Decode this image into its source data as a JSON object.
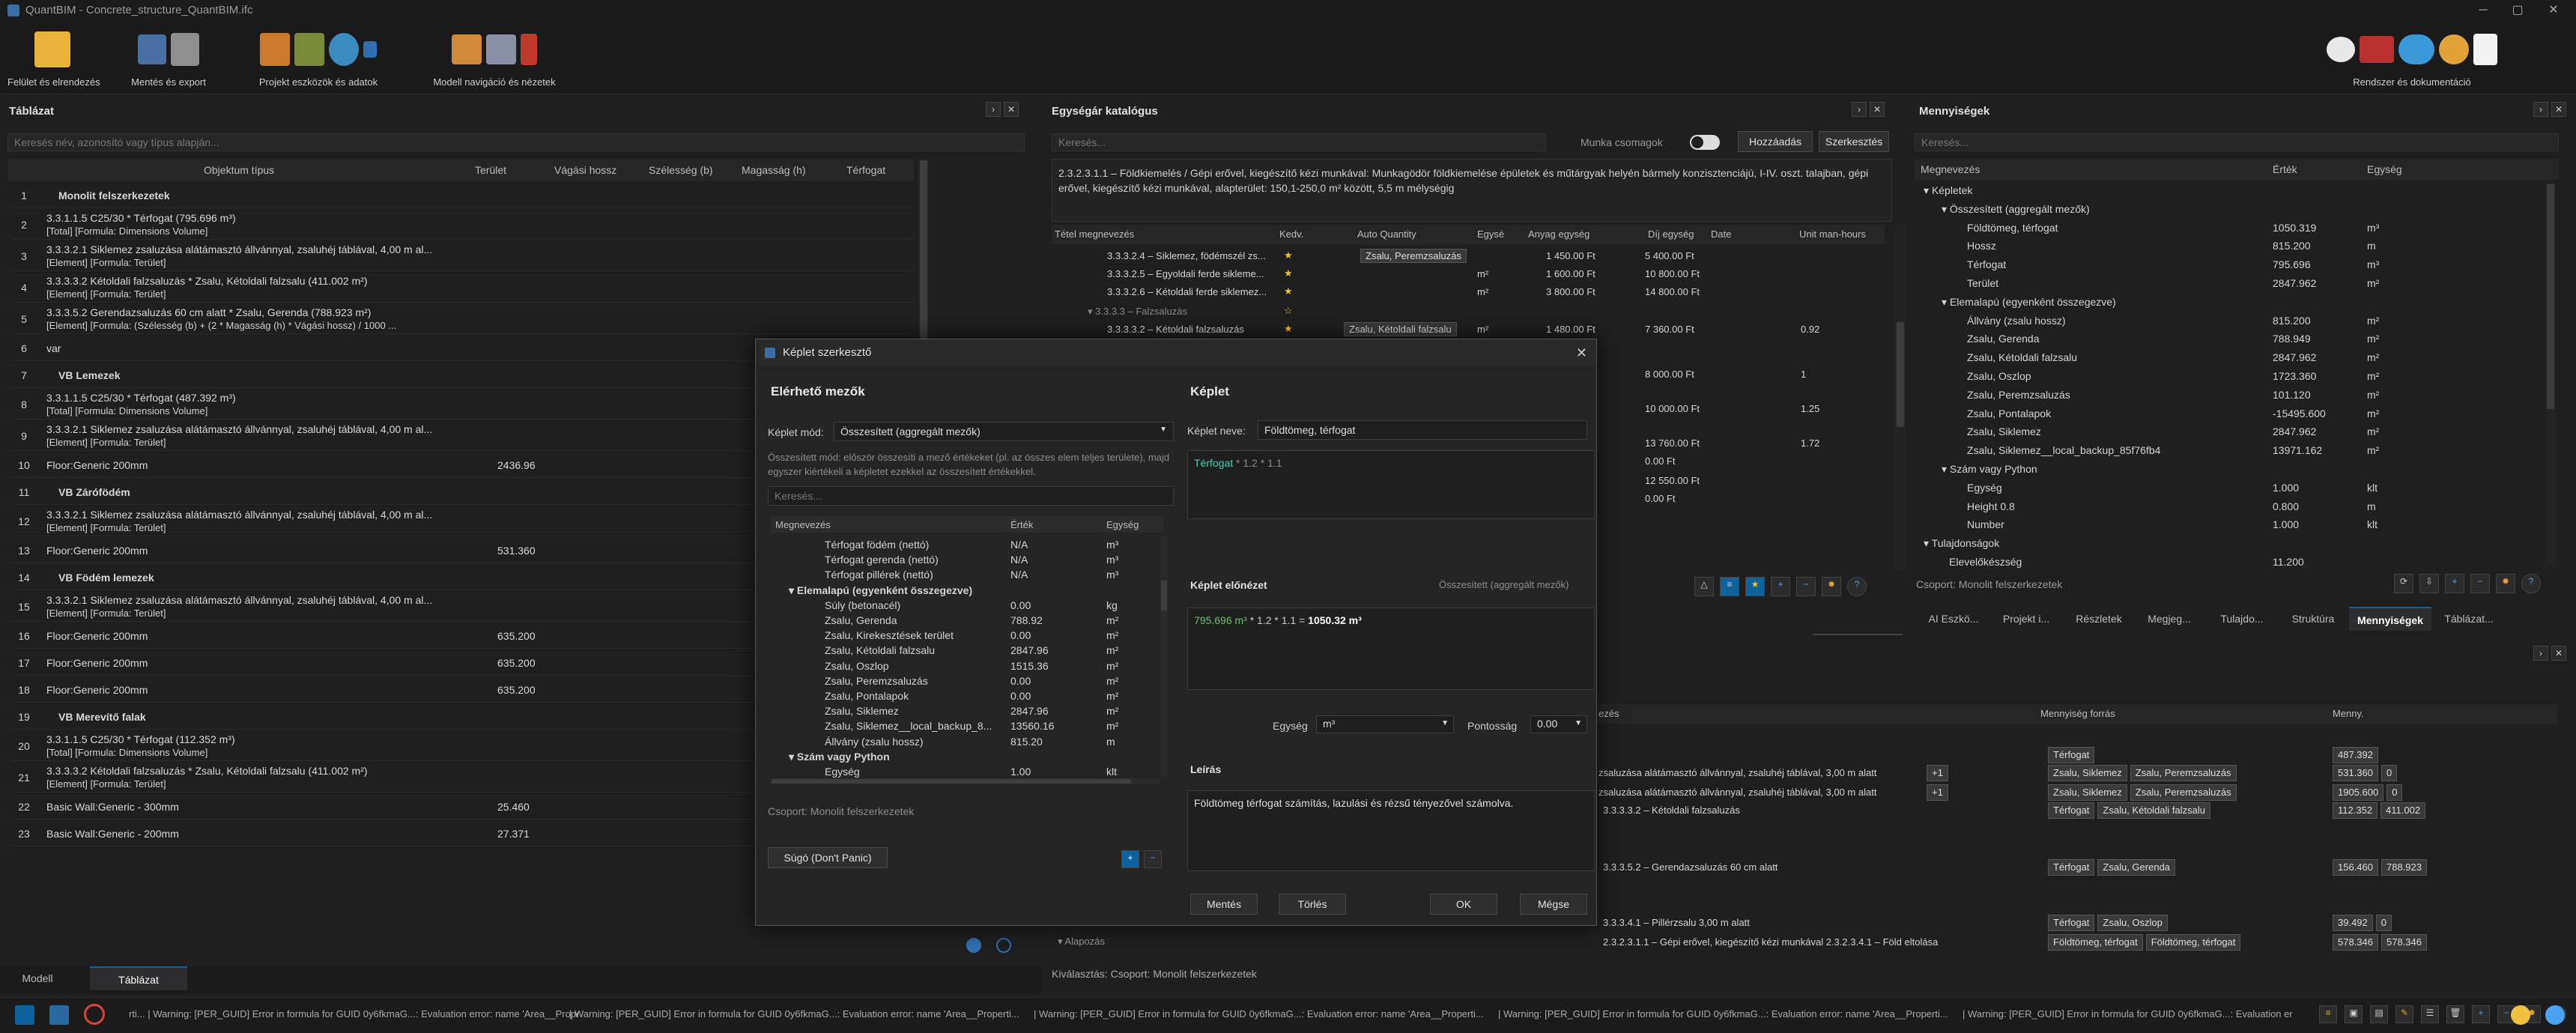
{
  "window": {
    "title": "QuantBIM - Concrete_structure_QuantBIM.ifc"
  },
  "ribbon": {
    "groups": [
      {
        "label": "Felület és elrendezés"
      },
      {
        "label": "Mentés és export"
      },
      {
        "label": "Projekt eszközök és adatok"
      },
      {
        "label": "Modell navigáció és nézetek"
      },
      {
        "label": "Rendszer és dokumentáció"
      }
    ]
  },
  "table_panel": {
    "title": "Táblázat",
    "search_placeholder": "Keresés név, azonosító vagy típus alapján...",
    "headers": [
      "Objektum típus",
      "Terület",
      "Vágási hossz",
      "Szélesség (b)",
      "Magasság (h)",
      "Térfogat"
    ],
    "rows": [
      {
        "num": "1",
        "text": "Monolit felszerkezetek",
        "group": true
      },
      {
        "num": "2",
        "text": "3.3.1.1.5 C25/30 * Térfogat   (795.696 m³)",
        "sub": "[Total] [Formula: Dimensions Volume]"
      },
      {
        "num": "3",
        "text": "3.3.3.2.1 Siklemez zsaluzása alátámasztó állvánnyal, zsaluhéj táblával, 4,00 m al...",
        "sub": "[Element] [Formula: Terület]"
      },
      {
        "num": "4",
        "text": "3.3.3.3.2 Kétoldali falzsaluzás * Zsalu, Kétoldali falzsalu   (411.002 m²)",
        "sub": "[Element] [Formula: Terület]"
      },
      {
        "num": "5",
        "text": "3.3.3.5.2 Gerendazsaluzás 60 cm alatt * Zsalu, Gerenda   (788.923 m²)",
        "sub": "[Element] [Formula: (Szélesség (b) + (2 * Magasság (h) * Vágási hossz) / 1000 ..."
      },
      {
        "num": "6",
        "text": "var"
      },
      {
        "num": "7",
        "text": "VB Lemezek",
        "group": true
      },
      {
        "num": "8",
        "text": "3.3.1.1.5 C25/30 * Térfogat   (487.392 m³)",
        "sub": "[Total] [Formula: Dimensions Volume]"
      },
      {
        "num": "9",
        "text": "3.3.3.2.1 Siklemez zsaluzása alátámasztó állvánnyal, zsaluhéj táblával, 4,00 m al...",
        "sub": "[Element] [Formula: Terület]"
      },
      {
        "num": "10",
        "text": "Floor:Generic 200mm",
        "area": "2436.96"
      },
      {
        "num": "11",
        "text": "VB Zárófödém",
        "group": true
      },
      {
        "num": "12",
        "text": "3.3.3.2.1 Siklemez zsaluzása alátámasztó állvánnyal, zsaluhéj táblával, 4,00 m al...",
        "sub": "[Element] [Formula: Terület]"
      },
      {
        "num": "13",
        "text": "Floor:Generic 200mm",
        "area": "531.360"
      },
      {
        "num": "14",
        "text": "VB Födém lemezek",
        "group": true
      },
      {
        "num": "15",
        "text": "3.3.3.2.1 Siklemez zsaluzása alátámasztó állvánnyal, zsaluhéj táblával, 4,00 m al...",
        "sub": "[Element] [Formula: Terület]"
      },
      {
        "num": "16",
        "text": "Floor:Generic 200mm",
        "area": "635.200"
      },
      {
        "num": "17",
        "text": "Floor:Generic 200mm",
        "area": "635.200"
      },
      {
        "num": "18",
        "text": "Floor:Generic 200mm",
        "area": "635.200"
      },
      {
        "num": "19",
        "text": "VB Merevítő falak",
        "group": true
      },
      {
        "num": "20",
        "text": "3.3.1.1.5 C25/30 * Térfogat   (112.352 m³)",
        "sub": "[Total] [Formula: Dimensions Volume]"
      },
      {
        "num": "21",
        "text": "3.3.3.3.2 Kétoldali falzsaluzás * Zsalu, Kétoldali falzsalu   (411.002 m²)",
        "sub": "[Element] [Formula: Terület]"
      },
      {
        "num": "22",
        "text": "Basic Wall:Generic - 300mm",
        "area": "25.460"
      },
      {
        "num": "23",
        "text": "Basic Wall:Generic - 200mm",
        "area": "27.371"
      }
    ],
    "bottom_tabs": [
      "Modell",
      "Táblázat"
    ]
  },
  "catalog_panel": {
    "title": "Egységár katalógus",
    "search_placeholder": "Keresés...",
    "work_packages_label": "Munka csomagok",
    "add_button": "Hozzáadás",
    "edit_button": "Szerkesztés",
    "description": "2.3.2.3.1.1 – Földkiemelés / Gépi erővel, kiegészítő kézi munkával: Munkagödör földkiemelése épületek és műtárgyak helyén bármely konzisztenciájú, I-IV. oszt. talajban, gépi erővel, kiegészítő kézi munkával, alapterület: 150,1-250,0 m² között, 5,5 m mélységig",
    "headers": [
      "Tétel megnevezés",
      "Kedv.",
      "Auto Quantity",
      "Egysé",
      "Anyag egység",
      "Díj egység",
      "Date",
      "Unit man-hours"
    ],
    "rows": [
      {
        "name": "3.3.3.2.4 – Siklemez, födémszél zs...",
        "fav": "★",
        "auto": "Zsalu, Peremzsaluzás",
        "unit": "",
        "mat": "1 450.00 Ft",
        "fee": "5 400.00 Ft",
        "mh": ""
      },
      {
        "name": "3.3.3.2.5 – Egyoldali ferde siklemе...",
        "fav": "★",
        "auto": "",
        "unit": "m²",
        "mat": "1 600.00 Ft",
        "fee": "10 800.00 Ft",
        "mh": ""
      },
      {
        "name": "3.3.3.2.6 – Kétoldali ferde siklemez...",
        "fav": "★",
        "auto": "",
        "unit": "m²",
        "mat": "3 800.00 Ft",
        "fee": "14 800.00 Ft",
        "mh": ""
      },
      {
        "name": "▾ 3.3.3.3 – Falzsaluzás",
        "fav": "☆",
        "auto": "",
        "unit": "",
        "mat": "",
        "fee": "",
        "mh": ""
      },
      {
        "name": "3.3.3.3.2 – Kétoldali falzsaluzás",
        "fav": "★",
        "auto": "Zsalu, Kétoldali falzsalu",
        "unit": "m²",
        "mat": "1 480.00 Ft",
        "fee": "7 360.00 Ft",
        "mh": "0.92"
      }
    ],
    "partial_rows": [
      {
        "fee": "8 000.00 Ft",
        "mh": "1"
      },
      {
        "fee": "10 000.00 Ft",
        "mh": "1.25"
      },
      {
        "fee": "13 760.00 Ft",
        "mh": "1.72"
      },
      {
        "fee": "0.00 Ft",
        "mh": ""
      },
      {
        "fee": "12 550.00 Ft",
        "mh": ""
      },
      {
        "fee": "0.00 Ft",
        "mh": ""
      }
    ],
    "selection_label": "Kiválasztás:  Csoport: Monolit felszerkezetek",
    "lower_headers": [
      "ezés",
      "Mennyiség forrás",
      "Menny."
    ],
    "lower_rows": [
      {
        "text": "",
        "src": [
          "Térfogat"
        ],
        "qty": [
          "487.392"
        ]
      },
      {
        "text": "zsaluzása alátámasztó állvánnyal, zsaluhéj táblával, 3,00 m alatt",
        "badge": "+1",
        "src": [
          "Zsalu, Siklemez",
          "Zsalu, Peremzsaluzás"
        ],
        "qty": [
          "531.360",
          "0"
        ]
      },
      {
        "text": "zsaluzása alátámasztó állvánnyal, zsaluhéj táblával, 3,00 m alatt",
        "badge": "+1",
        "src": [
          "Zsalu, Siklemez",
          "Zsalu, Peremzsaluzás"
        ],
        "qty": [
          "1905.600",
          "0"
        ]
      },
      {
        "text": "3.3.3.3.2 – Kétoldali falzsaluzás",
        "src": [
          "Térfogat",
          "Zsalu, Kétoldali falzsalu"
        ],
        "qty": [
          "112.352",
          "411.002"
        ]
      },
      {
        "text": "3.3.3.5.2 – Gerendazsaluzás 60 cm alatt",
        "src": [
          "Térfogat",
          "Zsalu, Gerenda"
        ],
        "qty": [
          "156.460",
          "788.923"
        ]
      },
      {
        "text": "3.3.3.4.1 – Pillérzsalu 3,00 m alatt",
        "src": [
          "Térfogat",
          "Zsalu, Oszlop"
        ],
        "qty": [
          "39.492",
          "0"
        ]
      },
      {
        "text": "2.3.2.3.1.1 – Gépi erővel, kiegészítő kézi munkával   2.3.2.3.4.1 – Föld eltolása",
        "src": [
          "Földtömeg, térfogat",
          "Földtömeg, térfogat"
        ],
        "qty": [
          "578.346",
          "578.346"
        ]
      }
    ],
    "lower_group": "▾ Alapozás"
  },
  "qty_panel": {
    "title": "Mennyiségek",
    "search_placeholder": "Keresés...",
    "headers": [
      "Megnevezés",
      "Érték",
      "Egység"
    ],
    "rows": [
      {
        "indent": 0,
        "name": "▾ Képletek",
        "val": "",
        "unit": ""
      },
      {
        "indent": 1,
        "name": "▾ Összesített (aggregált mezők)",
        "val": "",
        "unit": ""
      },
      {
        "indent": 2,
        "name": "Földtömeg, térfogat",
        "val": "1050.319",
        "unit": "m³"
      },
      {
        "indent": 2,
        "name": "Hossz",
        "val": "815.200",
        "unit": "m"
      },
      {
        "indent": 2,
        "name": "Térfogat",
        "val": "795.696",
        "unit": "m³"
      },
      {
        "indent": 2,
        "name": "Terület",
        "val": "2847.962",
        "unit": "m²"
      },
      {
        "indent": 1,
        "name": "▾ Elemalapú (egyenként összegezve)",
        "val": "",
        "unit": ""
      },
      {
        "indent": 2,
        "name": "Állvány (zsalu hossz)",
        "val": "815.200",
        "unit": "m²"
      },
      {
        "indent": 2,
        "name": "Zsalu, Gerenda",
        "val": "788.949",
        "unit": "m²"
      },
      {
        "indent": 2,
        "name": "Zsalu, Kétoldali falzsalu",
        "val": "2847.962",
        "unit": "m²"
      },
      {
        "indent": 2,
        "name": "Zsalu, Oszlop",
        "val": "1723.360",
        "unit": "m²"
      },
      {
        "indent": 2,
        "name": "Zsalu, Peremzsaluzás",
        "val": "101.120",
        "unit": "m²"
      },
      {
        "indent": 2,
        "name": "Zsalu, Pontalapok",
        "val": "-15495.600",
        "unit": "m²"
      },
      {
        "indent": 2,
        "name": "Zsalu, Siklemez",
        "val": "2847.962",
        "unit": "m²"
      },
      {
        "indent": 2,
        "name": "Zsalu, Siklemez__local_backup_85f76fb4",
        "val": "13971.162",
        "unit": "m²"
      },
      {
        "indent": 1,
        "name": "▾ Szám vagy Python",
        "val": "",
        "unit": ""
      },
      {
        "indent": 2,
        "name": "Egység",
        "val": "1.000",
        "unit": "klt"
      },
      {
        "indent": 2,
        "name": "Height 0.8",
        "val": "0.800",
        "unit": "m"
      },
      {
        "indent": 2,
        "name": "Number",
        "val": "1.000",
        "unit": "klt"
      },
      {
        "indent": 0,
        "name": "▾ Tulajdonságok",
        "val": "",
        "unit": ""
      },
      {
        "indent": 1,
        "name": "Elevelőkészség",
        "val": "11.200",
        "unit": ""
      }
    ],
    "group_label": "Csoport: Monolit felszerkezetek",
    "tabs": [
      "AI Eszkö...",
      "Projekt i...",
      "Részletek",
      "Megjeg...",
      "Tulajdo...",
      "Struktúra",
      "Mennyiségek",
      "Táblázat..."
    ]
  },
  "modal": {
    "title": "Képlet szerkesztő",
    "left_heading": "Elérhető mezők",
    "mode_label": "Képlet mód:",
    "mode_value": "Összesített (aggregált mezők)",
    "mode_help": "Összesített mód: először összesíti a mező értékeket (pl. az összes elem teljes területe), majd egyszer kiértékeli a képletet ezekkel az összesített értékekkel.",
    "search_placeholder": "Keresés...",
    "headers": [
      "Megnevezés",
      "Érték",
      "Egység"
    ],
    "rows": [
      {
        "indent": 2,
        "name": "Térfogat födém (nettó)",
        "val": "N/A",
        "unit": "m³"
      },
      {
        "indent": 2,
        "name": "Térfogat gerenda (nettó)",
        "val": "N/A",
        "unit": "m³"
      },
      {
        "indent": 2,
        "name": "Térfogat pillérek (nettó)",
        "val": "N/A",
        "unit": "m³"
      },
      {
        "indent": 1,
        "name": "▾ Elemalapú (egyenként összegezve)",
        "val": "",
        "unit": "",
        "bold": true
      },
      {
        "indent": 2,
        "name": "Súly (betonacél)",
        "val": "0.00",
        "unit": "kg"
      },
      {
        "indent": 2,
        "name": "Zsalu, Gerenda",
        "val": "788.92",
        "unit": "m²"
      },
      {
        "indent": 2,
        "name": "Zsalu, Kirekesztések terület",
        "val": "0.00",
        "unit": "m²"
      },
      {
        "indent": 2,
        "name": "Zsalu, Kétoldali falzsalu",
        "val": "2847.96",
        "unit": "m²"
      },
      {
        "indent": 2,
        "name": "Zsalu, Oszlop",
        "val": "1515.36",
        "unit": "m²"
      },
      {
        "indent": 2,
        "name": "Zsalu, Peremzsaluzás",
        "val": "0.00",
        "unit": "m²"
      },
      {
        "indent": 2,
        "name": "Zsalu, Pontalapok",
        "val": "0.00",
        "unit": "m²"
      },
      {
        "indent": 2,
        "name": "Zsalu, Siklemez",
        "val": "2847.96",
        "unit": "m²"
      },
      {
        "indent": 2,
        "name": "Zsalu, Siklemez__local_backup_8...",
        "val": "13560.16",
        "unit": "m²"
      },
      {
        "indent": 2,
        "name": "Állvány (zsalu hossz)",
        "val": "815.20",
        "unit": "m"
      },
      {
        "indent": 1,
        "name": "▾ Szám vagy Python",
        "val": "",
        "unit": "",
        "bold": true
      },
      {
        "indent": 2,
        "name": "Egység",
        "val": "1.00",
        "unit": "klt"
      }
    ],
    "group_label": "Csoport: Monolit felszerkezetek",
    "help_button": "Súgó (Don't Panic)",
    "right_heading": "Képlet",
    "name_label": "Képlet neve:",
    "name_value": "Földtömeg, térfogat",
    "formula_field": "Térfogat",
    "formula_rest": " * 1.2 * 1.1",
    "preview_label": "Képlet előnézet",
    "preview_mode": "Összesített (aggregált mezők)",
    "preview_val": "795.696 m³",
    "preview_rest": " * 1.2 * 1.1 = ",
    "preview_result": "1050.32 m³",
    "unit_label": "Egység",
    "unit_value": "m³",
    "precision_label": "Pontosság",
    "precision_value": "0.00",
    "desc_label": "Leírás",
    "desc_value": "Földtömeg térfogat számítás, lazulási és rézsű tényezővel számolva.",
    "save_button": "Mentés",
    "delete_button": "Törlés",
    "ok_button": "OK",
    "cancel_button": "Mégse"
  },
  "status": {
    "warnings": [
      "rti... | Warning: [PER_GUID] Error in formula for GUID 0y6fkmaG...: Evaluation error: name 'Area__Properti...",
      "| Warning: [PER_GUID] Error in formula for GUID 0y6fkmaG...: Evaluation error: name 'Area__Properti...",
      "| Warning: [PER_GUID] Error in formula for GUID 0y6fkmaG...: Evaluation error: name 'Area__Properti...",
      "| Warning: [PER_GUID] Error in formula for GUID 0y6fkmaG...: Evaluation error: name 'Area__Properti...",
      "| Warning: [PER_GUID] Error in formula for GUID 0y6fkmaG...: Evaluation error: name 'Area__Properti..."
    ]
  },
  "colors": {
    "accent": "#0e639c",
    "field_green": "#4ec9b0",
    "star": "#f2c21b",
    "selected_tab": "#2d2d30"
  }
}
